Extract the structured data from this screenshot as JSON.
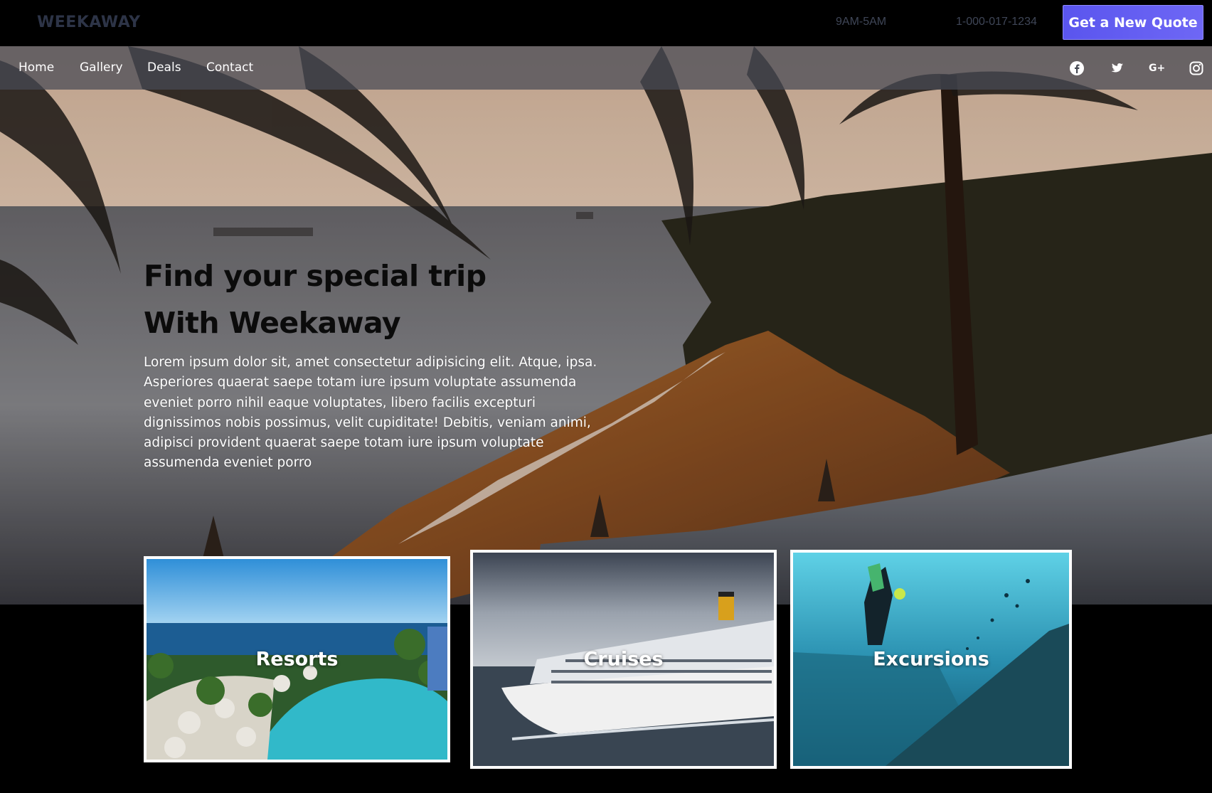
{
  "header": {
    "brand": "WEEKAWAY",
    "hours": "9AM-5AM",
    "phone": "1-000-017-1234",
    "quote_button": "Get a New Quote"
  },
  "nav": {
    "items": [
      {
        "label": "Home"
      },
      {
        "label": "Gallery"
      },
      {
        "label": "Deals"
      },
      {
        "label": "Contact"
      }
    ],
    "social": [
      "facebook-icon",
      "twitter-icon",
      "google-plus-icon",
      "instagram-icon"
    ],
    "google_plus_glyph": "G+"
  },
  "hero": {
    "title_line1": "Find your special trip",
    "title_line2": "With Weekaway",
    "description": "Lorem ipsum dolor sit, amet consectetur adipisicing elit. Atque, ipsa. Asperiores quaerat saepe totam iure ipsum voluptate assumenda eveniet porro nihil eaque voluptates, libero facilis excepturi dignissimos nobis possimus, velit cupiditate! Debitis, veniam animi, adipisci provident quaerat saepe totam iure ipsum voluptate assumenda eveniet porro"
  },
  "cards": [
    {
      "label": "Resorts"
    },
    {
      "label": "Cruises"
    },
    {
      "label": "Excursions"
    }
  ],
  "colors": {
    "accent": "#5a55ee",
    "background": "#000000",
    "nav_overlay": "#464a54"
  }
}
